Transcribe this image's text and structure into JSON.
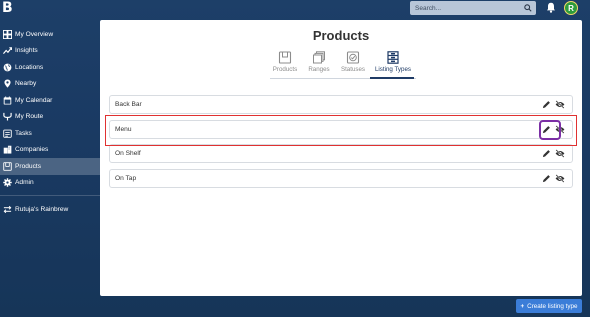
{
  "brand": {
    "logo_letter": "B"
  },
  "header": {
    "search_placeholder": "Search...",
    "avatar_initial": "R"
  },
  "sidebar": {
    "items": [
      {
        "label": "My Overview",
        "icon": "overview-icon"
      },
      {
        "label": "Insights",
        "icon": "insights-icon"
      },
      {
        "label": "Locations",
        "icon": "globe-icon"
      },
      {
        "label": "Nearby",
        "icon": "map-pin-icon"
      },
      {
        "label": "My Calendar",
        "icon": "calendar-icon"
      },
      {
        "label": "My Route",
        "icon": "route-icon"
      },
      {
        "label": "Tasks",
        "icon": "tasks-icon"
      },
      {
        "label": "Companies",
        "icon": "companies-icon"
      },
      {
        "label": "Products",
        "icon": "products-icon",
        "active": true
      },
      {
        "label": "Admin",
        "icon": "gear-icon"
      }
    ],
    "account": {
      "label": "Rutuja's Rainbrew",
      "icon": "switch-account-icon"
    }
  },
  "main": {
    "title": "Products",
    "tabs": [
      {
        "label": "Products",
        "icon": "product-box-icon"
      },
      {
        "label": "Ranges",
        "icon": "ranges-icon"
      },
      {
        "label": "Statuses",
        "icon": "statuses-icon"
      },
      {
        "label": "Listing Types",
        "icon": "listing-types-icon",
        "active": true
      }
    ],
    "listing_types": [
      {
        "name": "Back Bar"
      },
      {
        "name": "Menu"
      },
      {
        "name": "On Shelf"
      },
      {
        "name": "On Tap"
      }
    ],
    "create_button": {
      "label": "Create listing type"
    }
  },
  "colors": {
    "accent": "#3b7dd8",
    "highlight_red": "#e03131",
    "highlight_purple": "#7b2fa5",
    "nav_active": "#1f3b66",
    "background": "#1d3f68"
  }
}
